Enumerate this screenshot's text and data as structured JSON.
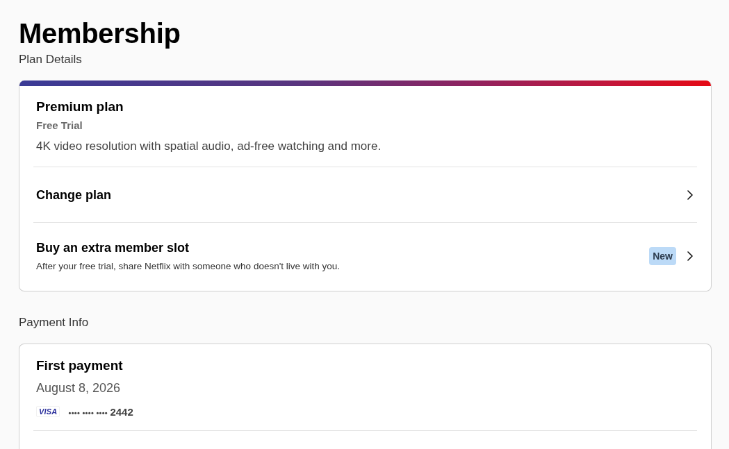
{
  "page": {
    "title": "Membership"
  },
  "plan_details": {
    "heading": "Plan Details",
    "plan": {
      "name": "Premium plan",
      "status": "Free Trial",
      "description": "4K video resolution with spatial audio, ad-free watching and more."
    },
    "rows": [
      {
        "title": "Change plan"
      },
      {
        "title": "Buy an extra member slot",
        "subtitle": "After your free trial, share Netflix with someone who doesn't live with you.",
        "badge": "New"
      }
    ]
  },
  "payment_info": {
    "heading": "Payment Info",
    "first_payment": {
      "label": "First payment",
      "date": "August 8, 2026",
      "card_brand": "VISA",
      "card_number": "•••• •••• •••• **2442**"
    }
  }
}
